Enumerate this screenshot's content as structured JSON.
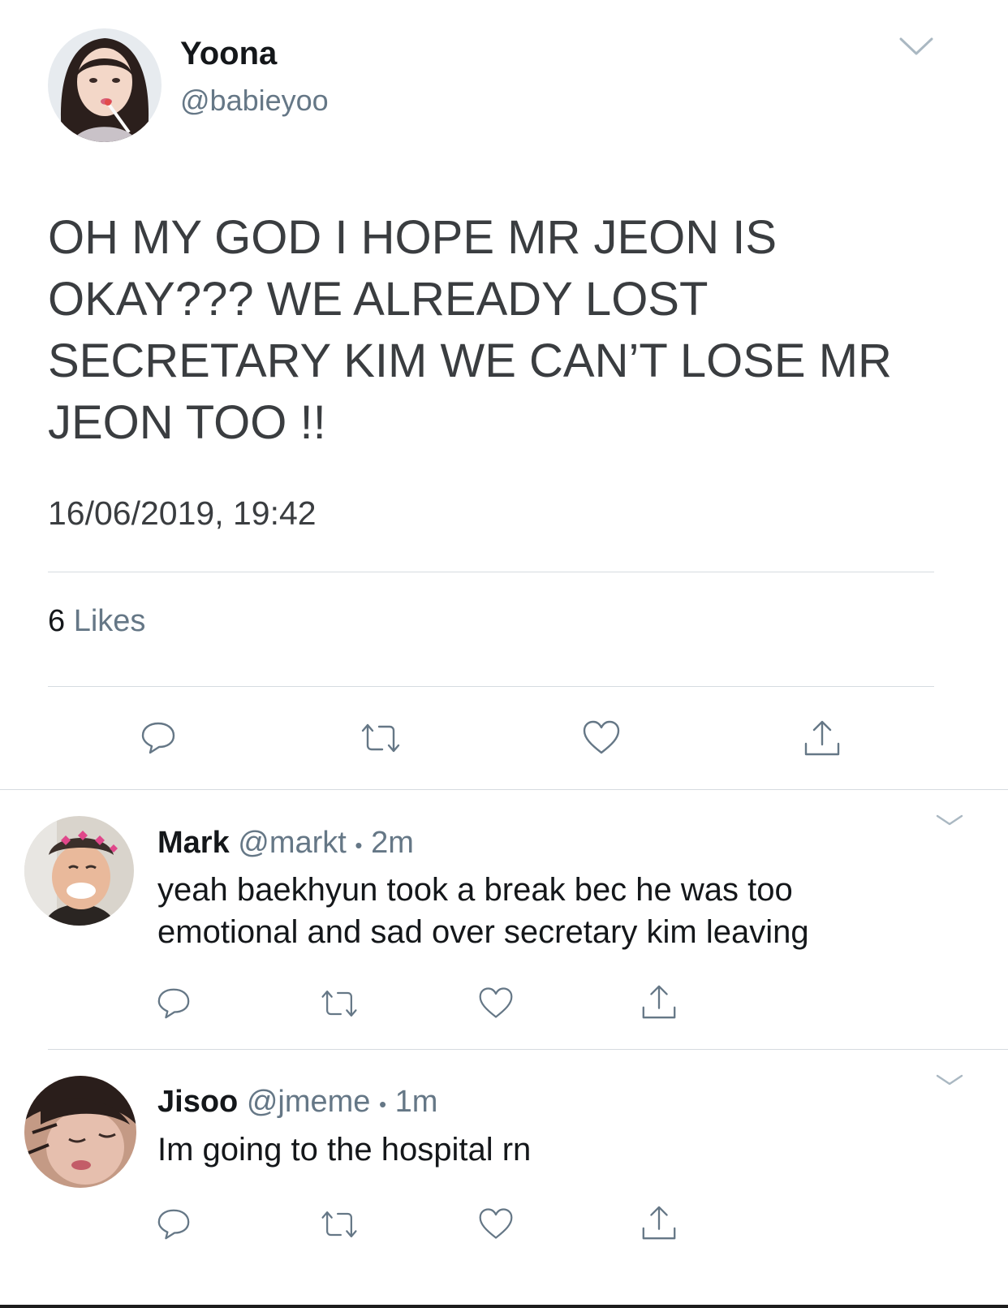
{
  "main_tweet": {
    "display_name": "Yoona",
    "handle": "@babieyoo",
    "text": "OH MY GOD I HOPE MR JEON IS OKAY??? WE ALREADY LOST SECRETARY KIM WE CAN’T LOSE MR JEON TOO !!",
    "timestamp": "16/06/2019, 19:42",
    "likes_count": "6",
    "likes_label": "Likes",
    "menu_icon": "chevron-down-icon"
  },
  "actions": {
    "icons": [
      "reply-icon",
      "retweet-icon",
      "like-icon",
      "share-icon"
    ]
  },
  "replies": [
    {
      "display_name": "Mark",
      "handle": "@markt",
      "separator": "•",
      "time": "2m",
      "text": "yeah baekhyun took a break bec he was too emotional and sad over secretary kim leaving"
    },
    {
      "display_name": "Jisoo",
      "handle": "@jmeme",
      "separator": "•",
      "time": "1m",
      "text": "Im going to the hospital rn"
    }
  ],
  "colors": {
    "text": "#14171a",
    "muted": "#657786",
    "divider": "#d6dbe0",
    "chevron": "#aab8c2"
  }
}
